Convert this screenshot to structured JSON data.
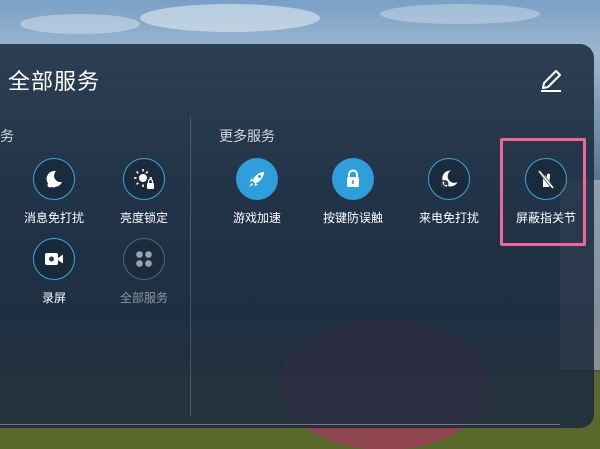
{
  "panel": {
    "title": "全部服务",
    "edit_icon": "pencil-edit-icon"
  },
  "sections": {
    "left_fragment_label": "务",
    "more_label": "更多服务"
  },
  "tiles": [
    {
      "label": "消息免打扰",
      "icon": "moon-do-not-disturb-icon",
      "style": "outline"
    },
    {
      "label": "亮度锁定",
      "icon": "brightness-lock-icon",
      "style": "outline"
    },
    {
      "label": "录屏",
      "icon": "screen-record-camera-icon",
      "style": "outline"
    },
    {
      "label": "全部服务",
      "icon": "grid-all-services-icon",
      "style": "dim"
    },
    {
      "label": "游戏加速",
      "icon": "rocket-icon",
      "style": "filled"
    },
    {
      "label": "按键防误触",
      "icon": "lock-icon",
      "style": "filled"
    },
    {
      "label": "来电免打扰",
      "icon": "phone-moon-icon",
      "style": "outline"
    },
    {
      "label": "屏蔽指关节",
      "icon": "knuckle-blocked-icon",
      "style": "outline"
    }
  ],
  "highlight": {
    "target": "屏蔽指关节",
    "color": "#f0659a"
  },
  "colors": {
    "accent": "#2f9fdc",
    "panel": "#1b2a3e",
    "highlight": "#f0659a"
  }
}
